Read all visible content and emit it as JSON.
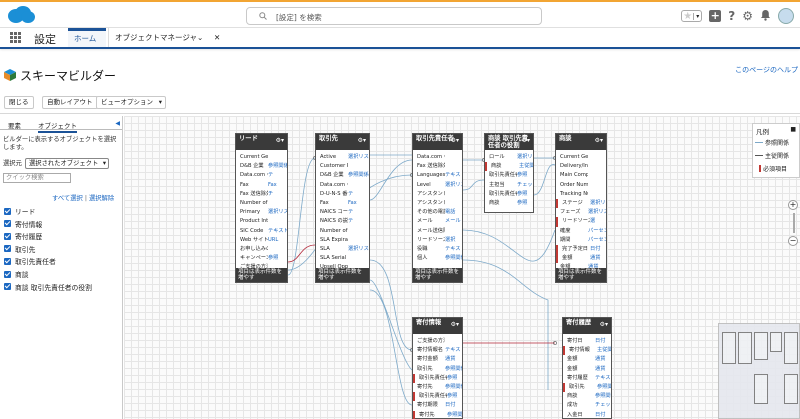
{
  "app": {
    "name": "設定"
  },
  "search": {
    "placeholder": "[設定] を検索"
  },
  "tabs": [
    {
      "label": "ホーム"
    },
    {
      "label": "オブジェクトマネージャ"
    }
  ],
  "page": {
    "title": "スキーマビルダー",
    "help_link": "このページのヘルプ"
  },
  "toolbar": {
    "close": "閉じる",
    "auto_layout": "自動レイアウト",
    "view_options": "ビューオプション"
  },
  "sidebar": {
    "tabs": [
      "要素",
      "オブジェクト"
    ],
    "instruction": "ビルダーに表示するオブジェクトを選択します。",
    "select_label": "選択元",
    "select_value": "選択されたオブジェクト",
    "quick_search": "クイック検索",
    "select_all": "すべて選択",
    "deselect": "選択解除",
    "objects": [
      {
        "label": "リード",
        "checked": true
      },
      {
        "label": "寄付情報",
        "checked": true
      },
      {
        "label": "寄付履歴",
        "checked": true
      },
      {
        "label": "取引先",
        "checked": true
      },
      {
        "label": "取引先責任者",
        "checked": true
      },
      {
        "label": "商談",
        "checked": true
      },
      {
        "label": "商談 取引先責任者の役割",
        "checked": true
      }
    ]
  },
  "legend": {
    "title": "凡例",
    "items": [
      "参照関係",
      "主従関係",
      "必須項目"
    ]
  },
  "nodes": {
    "lead": {
      "title": "リード",
      "footer": "項目は表示件数を増やす",
      "fields": [
        [
          "Current Generat",
          ""
        ],
        [
          "D&B 企業",
          "参照関係"
        ],
        [
          "Data.com キー",
          "テ"
        ],
        [
          "Fax",
          "Fax"
        ],
        [
          "Fax 送信除外",
          "チ"
        ],
        [
          "Number of Locat",
          ""
        ],
        [
          "Primary",
          "選択リス"
        ],
        [
          "Product Interest",
          ""
        ],
        [
          "SIC Code",
          "テキスト"
        ],
        [
          "Web サイト",
          "URL"
        ],
        [
          "お申し込みの",
          ""
        ],
        [
          "キャンペーン",
          "参照"
        ],
        [
          "ご支援の方法",
          ""
        ]
      ]
    },
    "account": {
      "title": "取引先",
      "footer": "項目は表示件数を増やす",
      "fields": [
        [
          "Active",
          "選択リスト"
        ],
        [
          "Customer Priorit",
          ""
        ],
        [
          "D&B 企業",
          "参照関係"
        ],
        [
          "Data.com キー",
          ""
        ],
        [
          "D-U-N-S 番号",
          "テ"
        ],
        [
          "Fax",
          "Fax"
        ],
        [
          "NAICS コード",
          "テ"
        ],
        [
          "NAICS の説明",
          "テ"
        ],
        [
          "Number of Locat",
          ""
        ],
        [
          "SLA Expiration D",
          ""
        ],
        [
          "SLA",
          "選択リスト"
        ],
        [
          "SLA Serial Numb",
          ""
        ],
        [
          "Upsell Opportun",
          ""
        ]
      ]
    },
    "contact": {
      "title": "取引先責任者",
      "footer": "項目は表示件数を増やす",
      "fields": [
        [
          "Data.com キー",
          ""
        ],
        [
          "Fax 送信除外",
          ""
        ],
        [
          "Languages",
          "テキスト"
        ],
        [
          "Level",
          "選択リスト"
        ],
        [
          "アシスタント",
          ""
        ],
        [
          "アシスタント電話",
          ""
        ],
        [
          "その他の電話",
          "電話"
        ],
        [
          "メール",
          "メール"
        ],
        [
          "メール送信除外",
          ""
        ],
        [
          "リードソース",
          "選択"
        ],
        [
          "役職",
          "テキスト"
        ],
        [
          "個人",
          "参照関係"
        ]
      ]
    },
    "ocr": {
      "title": "商談 取引先責任者の役割",
      "footer": "",
      "fields": [
        [
          "ロール",
          "選択リスト"
        ],
        [
          "商談",
          "主従関係"
        ],
        [
          "取引先責任者",
          "参照"
        ],
        [
          "主担当",
          "チェック"
        ],
        [
          "取引先責任者",
          "参照"
        ],
        [
          "商談",
          "参照"
        ]
      ]
    },
    "opportunity": {
      "title": "商談",
      "footer": "項目は表示件数を増やす",
      "fields": [
        [
          "Current Generat",
          ""
        ],
        [
          "Delivery/Install",
          ""
        ],
        [
          "Main Competitor",
          ""
        ],
        [
          "Order Number",
          ""
        ],
        [
          "Tracking Numbe",
          ""
        ],
        [
          "ステージ",
          "選択リス"
        ],
        [
          "フェーズ",
          "選択リス"
        ],
        [
          "リードソース",
          "選"
        ],
        [
          "確度",
          "パーセント"
        ],
        [
          "期間",
          "パーセン"
        ],
        [
          "完了予定日",
          "日付"
        ],
        [
          "金額",
          "通貨"
        ],
        [
          "金額",
          "通貨"
        ]
      ]
    },
    "donation": {
      "title": "寄付情報",
      "footer": "",
      "fields": [
        [
          "ご支援の方法",
          ""
        ],
        [
          "寄付情報名",
          "テキスト"
        ],
        [
          "寄付金額",
          "通貨"
        ],
        [
          "取引先",
          "参照関係"
        ],
        [
          "取引先責任者",
          "参照"
        ],
        [
          "寄付先",
          "参照関係"
        ],
        [
          "取引先責任者",
          "参照"
        ],
        [
          "寄付期限",
          "日付"
        ],
        [
          "寄付先",
          "参照関係"
        ]
      ]
    },
    "history": {
      "title": "寄付履歴",
      "footer": "",
      "fields": [
        [
          "寄付日",
          "日付"
        ],
        [
          "寄付情報",
          "主従関係"
        ],
        [
          "金額",
          "通貨"
        ],
        [
          "金額",
          "通貨"
        ],
        [
          "寄付履歴",
          "テキスト"
        ],
        [
          "取引先",
          "参照関係"
        ],
        [
          "商談",
          "参照関係"
        ],
        [
          "成功",
          "チェック"
        ],
        [
          "入金日",
          "日付"
        ]
      ]
    }
  },
  "colors": {
    "brand": "#1b5297",
    "accent": "#1b67c1",
    "required": "#c23934",
    "header": "#3a3a3a"
  }
}
